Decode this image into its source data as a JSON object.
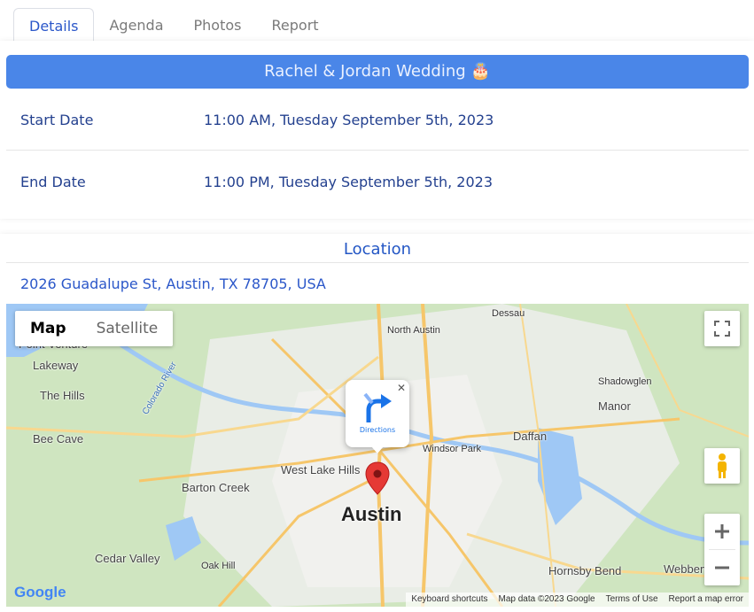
{
  "tabs": [
    {
      "label": "Details",
      "active": true
    },
    {
      "label": "Agenda",
      "active": false
    },
    {
      "label": "Photos",
      "active": false
    },
    {
      "label": "Report",
      "active": false
    }
  ],
  "details": {
    "title": "Rachel & Jordan Wedding 🎂",
    "start_label": "Start Date",
    "start_value": "11:00 AM, Tuesday September 5th, 2023",
    "end_label": "End Date",
    "end_value": "11:00 PM, Tuesday September 5th, 2023"
  },
  "location": {
    "title": "Location",
    "address": "2026 Guadalupe St, Austin, TX 78705, USA"
  },
  "map": {
    "type_map": "Map",
    "type_satellite": "Satellite",
    "popup_label": "Directions",
    "city": "Austin",
    "places": [
      "Point Venture",
      "Lakeway",
      "The Hills",
      "Bee Cave",
      "Barton Creek",
      "West Lake Hills",
      "North Austin",
      "Dessau",
      "Shadowglen",
      "Manor",
      "Daffan",
      "Windsor Park",
      "Oak Hill",
      "Cedar Valley",
      "Hornsby Bend",
      "Webberville",
      "Colorado River"
    ],
    "logo": "Google",
    "attribution": [
      "Keyboard shortcuts",
      "Map data ©2023 Google",
      "Terms of Use",
      "Report a map error"
    ],
    "colors": {
      "title_bar": "#4a86e8",
      "map_bg": "#cfe5c0",
      "water": "#9fc8f5",
      "marker": "#e53935"
    }
  }
}
